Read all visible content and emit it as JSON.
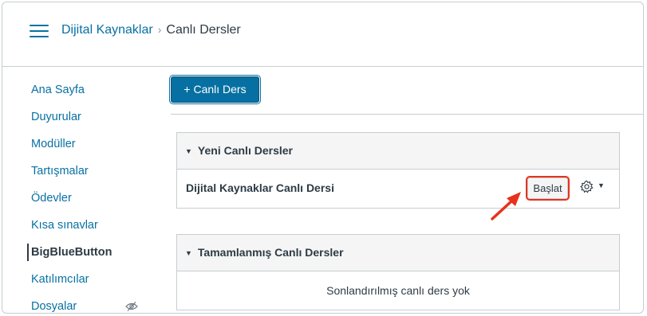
{
  "breadcrumb": {
    "course": "Dijital Kaynaklar",
    "separator": "›",
    "current": "Canlı Dersler"
  },
  "menu_icon": "hamburger-icon",
  "nav": {
    "items": [
      {
        "label": "Ana Sayfa"
      },
      {
        "label": "Duyurular"
      },
      {
        "label": "Modüller"
      },
      {
        "label": "Tartışmalar"
      },
      {
        "label": "Ödevler"
      },
      {
        "label": "Kısa sınavlar"
      },
      {
        "label": "BigBlueButton",
        "active": true
      },
      {
        "label": "Katılımcılar"
      },
      {
        "label": "Dosyalar",
        "hidden_icon": "eye-slash-icon"
      }
    ]
  },
  "toolbar": {
    "add_label": "+ Canlı Ders"
  },
  "upcoming": {
    "header": "Yeni Canlı Dersler",
    "rows": [
      {
        "title": "Dijital Kaynaklar Canlı Dersi",
        "start_label": "Başlat",
        "settings_icon": "gear-icon"
      }
    ]
  },
  "completed": {
    "header": "Tamamlanmış Canlı Dersler",
    "empty_text": "Sonlandırılmış canlı ders yok"
  },
  "colors": {
    "link": "#0770a3",
    "text": "#2d3b45",
    "highlight": "#e8311c",
    "border": "#c7cdd1"
  }
}
